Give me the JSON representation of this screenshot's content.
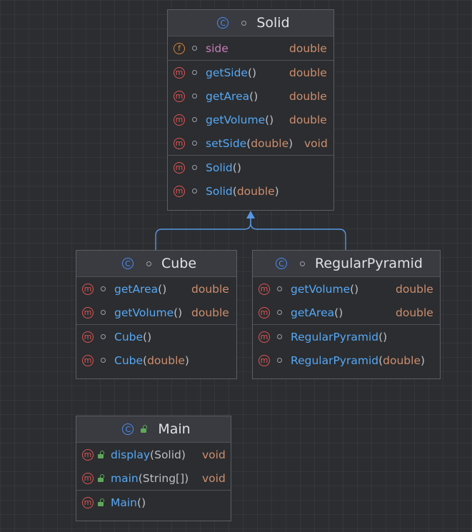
{
  "classes": {
    "solid": {
      "name": "Solid",
      "fields": [
        {
          "name": "side",
          "type": "double"
        }
      ],
      "methods": [
        {
          "name": "getSide",
          "open": "(",
          "params": "",
          "close": ")",
          "type": "double"
        },
        {
          "name": "getArea",
          "open": "(",
          "params": "",
          "close": ")",
          "type": "double"
        },
        {
          "name": "getVolume",
          "open": "(",
          "params": "",
          "close": ")",
          "type": "double"
        },
        {
          "name": "setSide",
          "open": "(",
          "params": "double",
          "close": ")",
          "type": "void"
        }
      ],
      "constructors": [
        {
          "name": "Solid",
          "open": "(",
          "params": "",
          "close": ")"
        },
        {
          "name": "Solid",
          "open": "(",
          "params": "double",
          "close": ")"
        }
      ]
    },
    "cube": {
      "name": "Cube",
      "methods": [
        {
          "name": "getArea",
          "open": "(",
          "params": "",
          "close": ")",
          "type": "double"
        },
        {
          "name": "getVolume",
          "open": "(",
          "params": "",
          "close": ")",
          "type": "double"
        }
      ],
      "constructors": [
        {
          "name": "Cube",
          "open": "(",
          "params": "",
          "close": ")"
        },
        {
          "name": "Cube",
          "open": "(",
          "params": "double",
          "close": ")"
        }
      ]
    },
    "pyramid": {
      "name": "RegularPyramid",
      "methods": [
        {
          "name": "getVolume",
          "open": "(",
          "params": "",
          "close": ")",
          "type": "double"
        },
        {
          "name": "getArea",
          "open": "(",
          "params": "",
          "close": ")",
          "type": "double"
        }
      ],
      "constructors": [
        {
          "name": "RegularPyramid",
          "open": "(",
          "params": "",
          "close": ")"
        },
        {
          "name": "RegularPyramid",
          "open": "(",
          "params": "double",
          "close": ")"
        }
      ]
    },
    "main": {
      "name": "Main",
      "methods": [
        {
          "name": "display",
          "open": "(",
          "params": "Solid",
          "close": ")",
          "type": "void"
        },
        {
          "name": "main",
          "open": "(",
          "params": "String[]",
          "close": ")",
          "type": "void"
        }
      ],
      "constructors": [
        {
          "name": "Main",
          "open": "(",
          "params": "",
          "close": ")"
        }
      ]
    }
  },
  "icons": {
    "class": "C",
    "method": "m",
    "field": "f",
    "class_icon": "class-icon",
    "method_icon": "method-icon",
    "field_icon": "field-icon",
    "visibility_package": "package-visibility-icon",
    "visibility_public": "public-lock-icon"
  },
  "colors": {
    "background": "#2b2d30",
    "header": "#393b40",
    "border": "#5b5e64",
    "method_name": "#56a8f5",
    "field_name": "#c77dbb",
    "type": "#cf8e6d",
    "paren": "#bcbec4",
    "method_icon": "#e05555",
    "field_icon": "#d9843a",
    "class_icon": "#4c8df6",
    "edge": "#5796e3"
  },
  "relations": [
    {
      "from": "Cube",
      "to": "Solid",
      "kind": "extends"
    },
    {
      "from": "RegularPyramid",
      "to": "Solid",
      "kind": "extends"
    }
  ]
}
